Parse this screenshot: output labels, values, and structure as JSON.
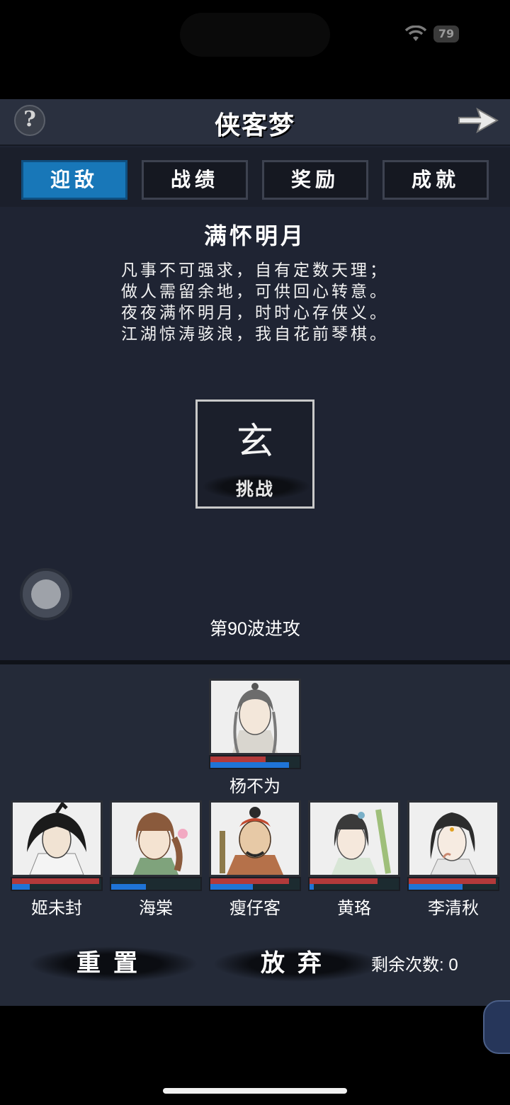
{
  "status_bar": {
    "battery": "79"
  },
  "header": {
    "title": "侠客梦",
    "help_label": "?"
  },
  "tabs": [
    {
      "label": "迎敌",
      "active": true
    },
    {
      "label": "战绩",
      "active": false
    },
    {
      "label": "奖励",
      "active": false
    },
    {
      "label": "成就",
      "active": false
    }
  ],
  "poem": {
    "title": "满怀明月",
    "lines": [
      "凡事不可强求，自有定数天理；",
      "做人需留余地，可供回心转意。",
      "夜夜满怀明月，时时心存侠义。",
      "江湖惊涛骇浪，我自花前琴棋。"
    ]
  },
  "challenge": {
    "glyph": "玄",
    "label": "挑战"
  },
  "wave": {
    "label": "第90波进攻"
  },
  "team": {
    "leader": {
      "name": "杨不为",
      "hp": 0.62,
      "mp": 0.88
    },
    "members": [
      {
        "name": "姬未封",
        "hp": 0.98,
        "mp": 0.2
      },
      {
        "name": "海棠",
        "hp": 0.0,
        "mp": 0.39
      },
      {
        "name": "瘦仔客",
        "hp": 0.88,
        "mp": 0.48
      },
      {
        "name": "黄珞",
        "hp": 0.76,
        "mp": 0.05
      },
      {
        "name": "李清秋",
        "hp": 0.98,
        "mp": 0.6
      }
    ]
  },
  "actions": {
    "reset_label": "重置",
    "abandon_label": "放弃",
    "remaining_label": "剩余次数: 0"
  },
  "colors": {
    "accent_tab": "#1877b8",
    "hp_bar": "#b23a3a",
    "mp_bar": "#1f74d6",
    "background": "#1f2433"
  }
}
